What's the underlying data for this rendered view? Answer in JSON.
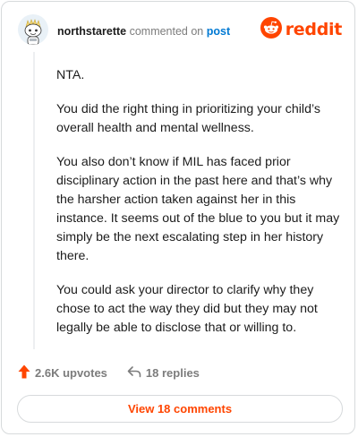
{
  "header": {
    "username": "northstarette",
    "action_text": "commented on",
    "post_link": "post",
    "brand_name": "reddit",
    "avatar_icon": "snoo-avatar-icon",
    "brand_icon": "reddit-alien-icon"
  },
  "comment": {
    "paragraphs": [
      "NTA.",
      "You did the right thing in prioritizing your child’s overall health and mental wellness.",
      "You also don’t know if MIL has faced prior disciplinary action in the past here and that’s why the harsher action taken against her in this instance. It seems out of the blue to you but it may simply be the next escalating step in her history there.",
      "You could ask your director to clarify why they chose to act the way they did but they may not legally be able to disclose that or willing to."
    ]
  },
  "footer": {
    "upvotes": "2.6K upvotes",
    "replies": "18 replies",
    "upvote_icon": "upvote-arrow-icon",
    "reply_icon": "reply-arrow-icon"
  },
  "view_button": {
    "label": "View 18 comments"
  },
  "colors": {
    "brand": "#ff4500",
    "link": "#0079d3",
    "muted": "#7c7c7c",
    "text": "#1c1c1c",
    "border": "#d7dadc"
  }
}
